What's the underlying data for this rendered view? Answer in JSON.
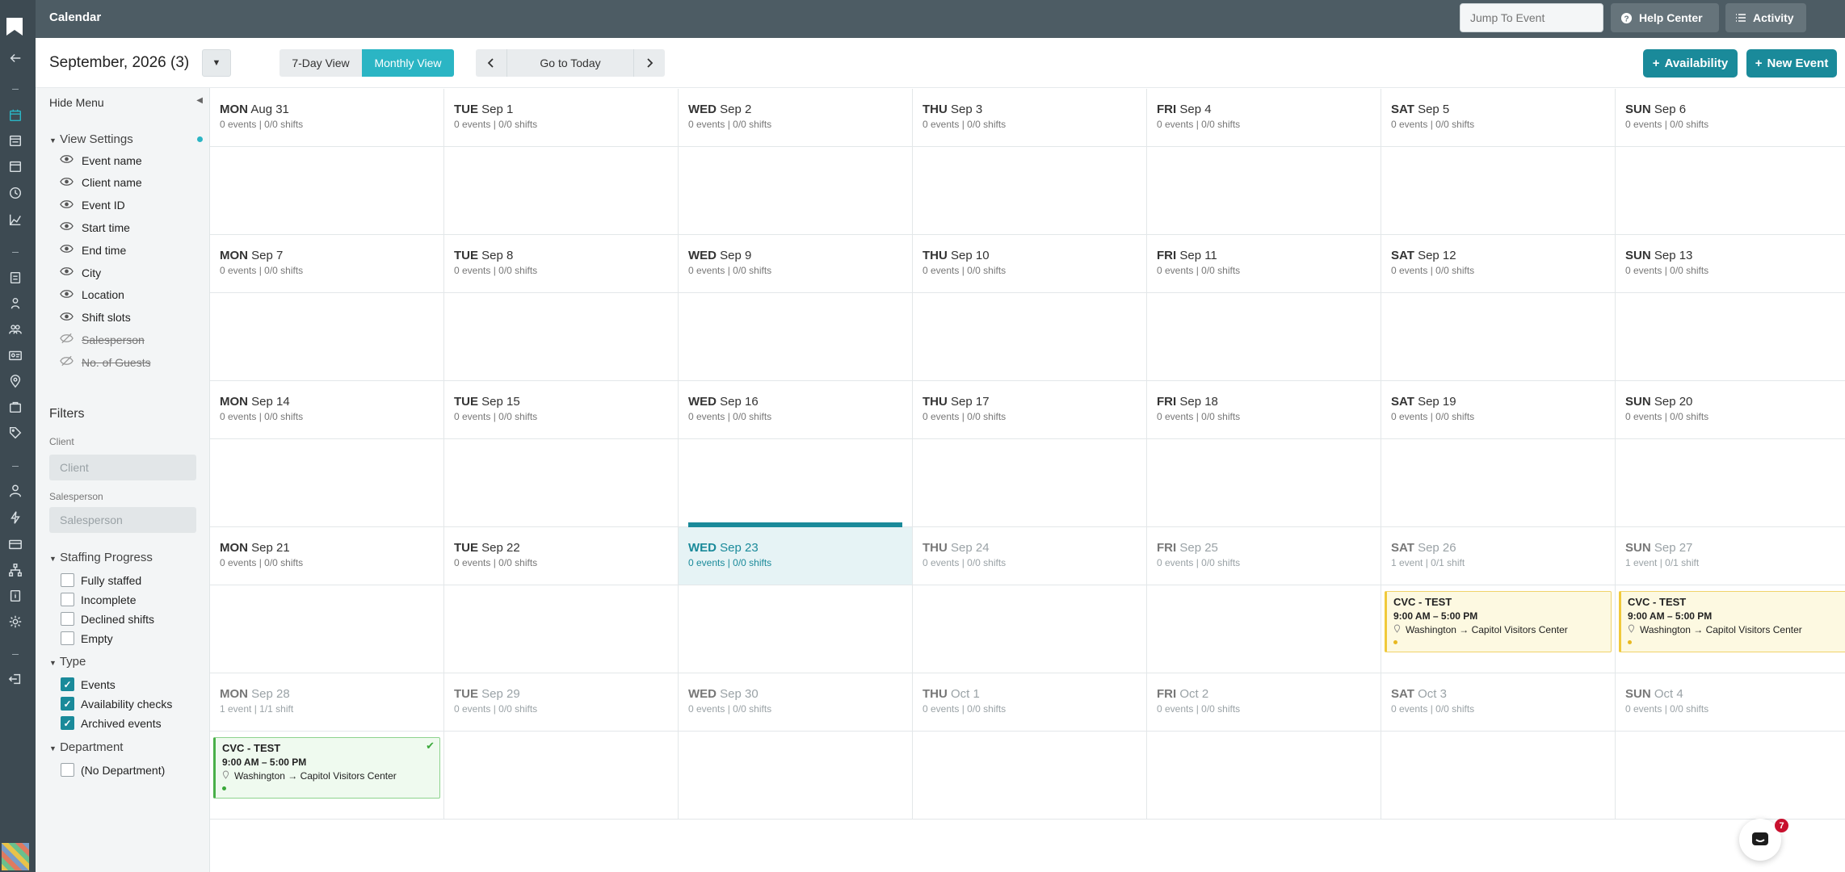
{
  "app": {
    "title": "Calendar"
  },
  "topbar": {
    "jump_placeholder": "Jump To Event",
    "help_label": "Help Center",
    "activity_label": "Activity"
  },
  "subhead": {
    "month_title": "September, 2026 (3)",
    "dropdown_icon": "▼",
    "view_7day": "7-Day View",
    "view_monthly": "Monthly View",
    "active_view": "Monthly View",
    "today_label": "Go to Today",
    "availability_label": "Availability",
    "new_event_label": "New Event"
  },
  "sidemenu": {
    "hide_menu": "Hide Menu",
    "view_settings_title": "View Settings",
    "view_settings": [
      {
        "label": "Event name",
        "visible": true
      },
      {
        "label": "Client name",
        "visible": true
      },
      {
        "label": "Event ID",
        "visible": true
      },
      {
        "label": "Start time",
        "visible": true
      },
      {
        "label": "End time",
        "visible": true
      },
      {
        "label": "City",
        "visible": true
      },
      {
        "label": "Location",
        "visible": true
      },
      {
        "label": "Shift slots",
        "visible": true
      },
      {
        "label": "Salesperson",
        "visible": false
      },
      {
        "label": "No. of Guests",
        "visible": false
      }
    ],
    "filters_title": "Filters",
    "client_label": "Client",
    "client_placeholder": "Client",
    "salesperson_label": "Salesperson",
    "salesperson_placeholder": "Salesperson",
    "staffing_title": "Staffing Progress",
    "staffing": [
      {
        "label": "Fully staffed",
        "checked": false
      },
      {
        "label": "Incomplete",
        "checked": false
      },
      {
        "label": "Declined shifts",
        "checked": false
      },
      {
        "label": "Empty",
        "checked": false
      }
    ],
    "type_title": "Type",
    "types": [
      {
        "label": "Events",
        "checked": true
      },
      {
        "label": "Availability checks",
        "checked": true
      },
      {
        "label": "Archived events",
        "checked": true
      }
    ],
    "department_title": "Department",
    "departments": [
      {
        "label": "(No Department)",
        "checked": false
      }
    ]
  },
  "calendar": {
    "weeks": [
      [
        {
          "dow": "MON",
          "date": "Aug 31",
          "summary": "0 events | 0/0 shifts"
        },
        {
          "dow": "TUE",
          "date": "Sep 1",
          "summary": "0 events | 0/0 shifts"
        },
        {
          "dow": "WED",
          "date": "Sep 2",
          "summary": "0 events | 0/0 shifts"
        },
        {
          "dow": "THU",
          "date": "Sep 3",
          "summary": "0 events | 0/0 shifts"
        },
        {
          "dow": "FRI",
          "date": "Sep 4",
          "summary": "0 events | 0/0 shifts"
        },
        {
          "dow": "SAT",
          "date": "Sep 5",
          "summary": "0 events | 0/0 shifts"
        },
        {
          "dow": "SUN",
          "date": "Sep 6",
          "summary": "0 events | 0/0 shifts"
        }
      ],
      [
        {
          "dow": "MON",
          "date": "Sep 7",
          "summary": "0 events | 0/0 shifts"
        },
        {
          "dow": "TUE",
          "date": "Sep 8",
          "summary": "0 events | 0/0 shifts"
        },
        {
          "dow": "WED",
          "date": "Sep 9",
          "summary": "0 events | 0/0 shifts"
        },
        {
          "dow": "THU",
          "date": "Sep 10",
          "summary": "0 events | 0/0 shifts"
        },
        {
          "dow": "FRI",
          "date": "Sep 11",
          "summary": "0 events | 0/0 shifts"
        },
        {
          "dow": "SAT",
          "date": "Sep 12",
          "summary": "0 events | 0/0 shifts"
        },
        {
          "dow": "SUN",
          "date": "Sep 13",
          "summary": "0 events | 0/0 shifts"
        }
      ],
      [
        {
          "dow": "MON",
          "date": "Sep 14",
          "summary": "0 events | 0/0 shifts"
        },
        {
          "dow": "TUE",
          "date": "Sep 15",
          "summary": "0 events | 0/0 shifts"
        },
        {
          "dow": "WED",
          "date": "Sep 16",
          "summary": "0 events | 0/0 shifts"
        },
        {
          "dow": "THU",
          "date": "Sep 17",
          "summary": "0 events | 0/0 shifts"
        },
        {
          "dow": "FRI",
          "date": "Sep 18",
          "summary": "0 events | 0/0 shifts"
        },
        {
          "dow": "SAT",
          "date": "Sep 19",
          "summary": "0 events | 0/0 shifts"
        },
        {
          "dow": "SUN",
          "date": "Sep 20",
          "summary": "0 events | 0/0 shifts"
        }
      ],
      [
        {
          "dow": "MON",
          "date": "Sep 21",
          "summary": "0 events | 0/0 shifts"
        },
        {
          "dow": "TUE",
          "date": "Sep 22",
          "summary": "0 events | 0/0 shifts"
        },
        {
          "dow": "WED",
          "date": "Sep 23",
          "summary": "0 events | 0/0 shifts",
          "today": true
        },
        {
          "dow": "THU",
          "date": "Sep 24",
          "summary": "0 events | 0/0 shifts",
          "muted": true
        },
        {
          "dow": "FRI",
          "date": "Sep 25",
          "summary": "0 events | 0/0 shifts",
          "muted": true
        },
        {
          "dow": "SAT",
          "date": "Sep 26",
          "summary": "1 event | 0/1 shift",
          "muted": true,
          "event": {
            "title": "CVC - TEST",
            "time": "9:00 AM – 5:00 PM",
            "location": "Washington → Capitol Visitors Center",
            "status": "yellow"
          }
        },
        {
          "dow": "SUN",
          "date": "Sep 27",
          "summary": "1 event | 0/1 shift",
          "muted": true,
          "event": {
            "title": "CVC - TEST",
            "time": "9:00 AM – 5:00 PM",
            "location": "Washington → Capitol Visitors Center",
            "status": "yellow"
          }
        }
      ],
      [
        {
          "dow": "MON",
          "date": "Sep 28",
          "summary": "1 event | 1/1 shift",
          "muted": true,
          "event": {
            "title": "CVC - TEST",
            "time": "9:00 AM – 5:00 PM",
            "location": "Washington → Capitol Visitors Center",
            "status": "green",
            "check": "✔"
          }
        },
        {
          "dow": "TUE",
          "date": "Sep 29",
          "summary": "0 events | 0/0 shifts",
          "muted": true
        },
        {
          "dow": "WED",
          "date": "Sep 30",
          "summary": "0 events | 0/0 shifts",
          "muted": true
        },
        {
          "dow": "THU",
          "date": "Oct 1",
          "summary": "0 events | 0/0 shifts",
          "muted": true
        },
        {
          "dow": "FRI",
          "date": "Oct 2",
          "summary": "0 events | 0/0 shifts",
          "muted": true
        },
        {
          "dow": "SAT",
          "date": "Oct 3",
          "summary": "0 events | 0/0 shifts",
          "muted": true
        },
        {
          "dow": "SUN",
          "date": "Oct 4",
          "summary": "0 events | 0/0 shifts",
          "muted": true
        }
      ]
    ]
  },
  "chat": {
    "badge": "7"
  },
  "colors": {
    "accent": "#1a8a9a",
    "accent_light": "#2bb5c4",
    "rail": "#3d4a52",
    "topbar": "#4d5c64"
  }
}
